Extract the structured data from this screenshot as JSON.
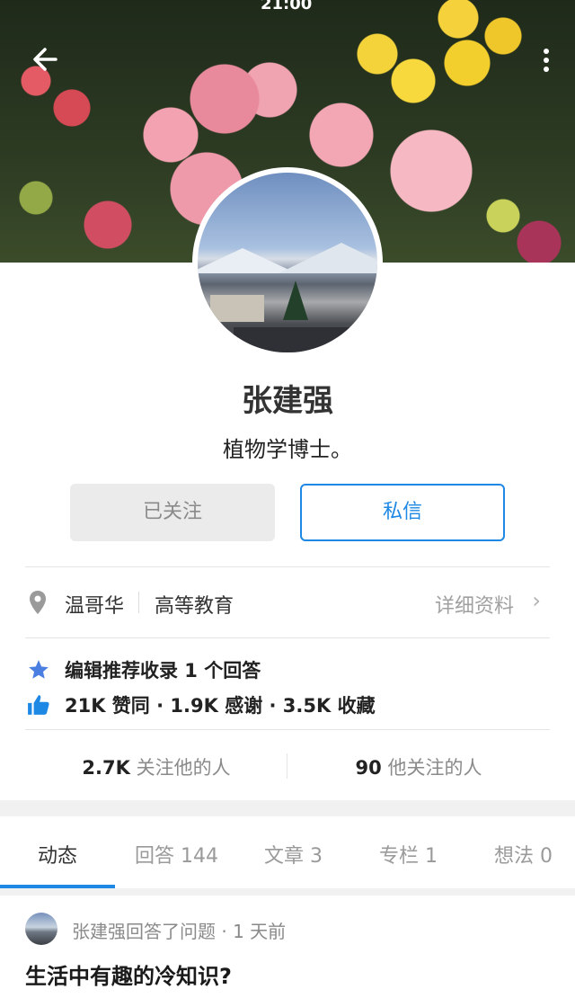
{
  "status_bar": {
    "time": "21:00"
  },
  "profile": {
    "name": "张建强",
    "bio": "植物学博士。",
    "followed_label": "已关注",
    "message_label": "私信"
  },
  "info": {
    "location": "温哥华",
    "industry": "高等教育",
    "detail_label": "详细资料"
  },
  "achievements": {
    "recommend": "编辑推荐收录 1 个回答",
    "stats": "21K 赞同 · 1.9K 感谢 · 3.5K 收藏"
  },
  "follow": {
    "followers_count": "2.7K",
    "followers_label": "关注他的人",
    "following_count": "90",
    "following_label": "他关注的人"
  },
  "tabs": [
    {
      "label": "动态",
      "count": ""
    },
    {
      "label": "回答",
      "count": "144"
    },
    {
      "label": "文章",
      "count": "3"
    },
    {
      "label": "专栏",
      "count": "1"
    },
    {
      "label": "想法",
      "count": "0"
    }
  ],
  "feed": {
    "meta": "张建强回答了问题 · 1 天前",
    "title": "生活中有趣的冷知识?"
  },
  "colors": {
    "accent": "#1e88e5",
    "star": "#4a7ee0",
    "thumb": "#1e88e5"
  },
  "icons": [
    "back-arrow-icon",
    "more-vert-icon",
    "location-pin-icon",
    "star-icon",
    "thumb-up-icon",
    "chevron-right-icon"
  ]
}
